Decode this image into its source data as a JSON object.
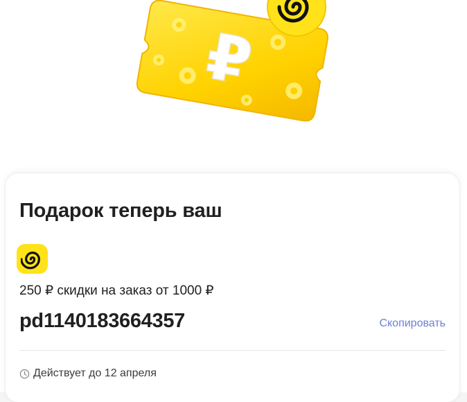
{
  "card": {
    "title": "Подарок теперь ваш",
    "discount": "250 ₽ скидки на заказ от 1000 ₽",
    "promo_code": "pd1140183664357",
    "copy_label": "Скопировать",
    "validity": "Действует до 12 апреля"
  },
  "icons": {
    "hero": "ruble-gift-ticket-icon",
    "brand": "spiral-logo-icon",
    "clock": "clock-icon"
  },
  "colors": {
    "brand_yellow": "#ffe21a",
    "link": "#6c80d6",
    "text": "#21201f"
  }
}
